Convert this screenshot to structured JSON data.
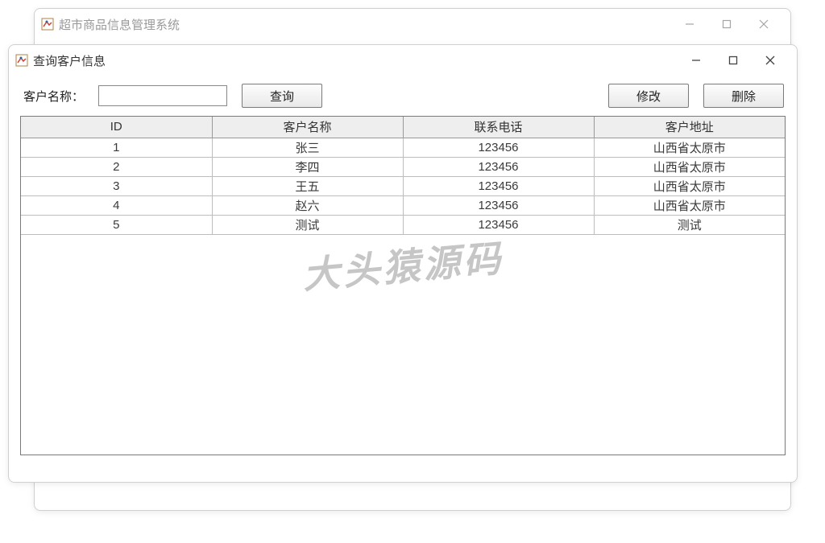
{
  "outerWindow": {
    "title": "超市商品信息管理系统"
  },
  "innerWindow": {
    "title": "查询客户信息"
  },
  "form": {
    "nameLabel": "客户名称：",
    "nameValue": "",
    "queryBtn": "查询",
    "editBtn": "修改",
    "deleteBtn": "删除"
  },
  "table": {
    "headers": [
      "ID",
      "客户名称",
      "联系电话",
      "客户地址"
    ],
    "rows": [
      {
        "id": "1",
        "name": "张三",
        "phone": "123456",
        "addr": "山西省太原市"
      },
      {
        "id": "2",
        "name": "李四",
        "phone": "123456",
        "addr": "山西省太原市"
      },
      {
        "id": "3",
        "name": "王五",
        "phone": "123456",
        "addr": "山西省太原市"
      },
      {
        "id": "4",
        "name": "赵六",
        "phone": "123456",
        "addr": "山西省太原市"
      },
      {
        "id": "5",
        "name": "测试",
        "phone": "123456",
        "addr": "测试"
      }
    ]
  },
  "watermark": "大头猿源码"
}
